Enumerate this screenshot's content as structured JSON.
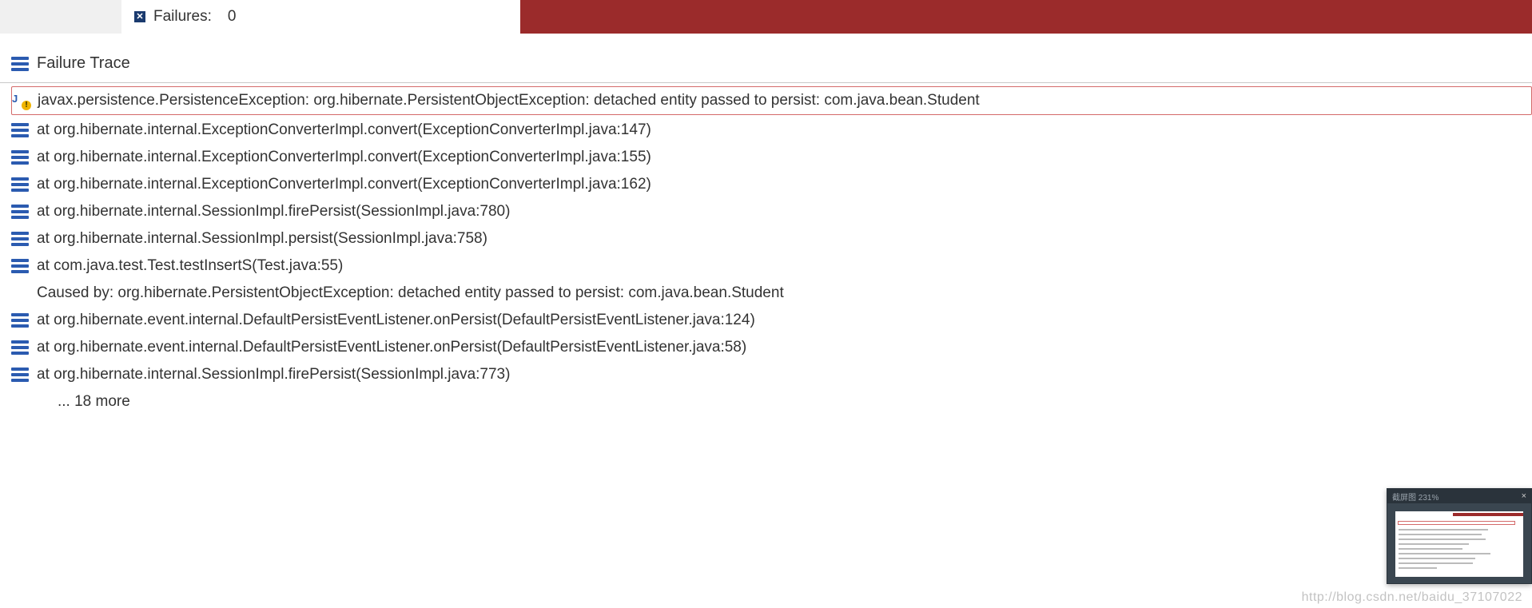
{
  "header": {
    "failures_label": "Failures:",
    "failures_count": "0"
  },
  "section": {
    "title": "Failure Trace"
  },
  "trace": {
    "exception": "javax.persistence.PersistenceException: org.hibernate.PersistentObjectException: detached entity passed to persist: com.java.bean.Student",
    "lines": [
      "at org.hibernate.internal.ExceptionConverterImpl.convert(ExceptionConverterImpl.java:147)",
      "at org.hibernate.internal.ExceptionConverterImpl.convert(ExceptionConverterImpl.java:155)",
      "at org.hibernate.internal.ExceptionConverterImpl.convert(ExceptionConverterImpl.java:162)",
      "at org.hibernate.internal.SessionImpl.firePersist(SessionImpl.java:780)",
      "at org.hibernate.internal.SessionImpl.persist(SessionImpl.java:758)",
      "at com.java.test.Test.testInsertS(Test.java:55)"
    ],
    "caused_by": "Caused by: org.hibernate.PersistentObjectException: detached entity passed to persist: com.java.bean.Student",
    "caused_lines": [
      "at org.hibernate.event.internal.DefaultPersistEventListener.onPersist(DefaultPersistEventListener.java:124)",
      "at org.hibernate.event.internal.DefaultPersistEventListener.onPersist(DefaultPersistEventListener.java:58)",
      "at org.hibernate.internal.SessionImpl.firePersist(SessionImpl.java:773)"
    ],
    "more": "... 18 more"
  },
  "thumbnail": {
    "title": "截屏图 231%"
  },
  "watermark": "http://blog.csdn.net/baidu_37107022"
}
